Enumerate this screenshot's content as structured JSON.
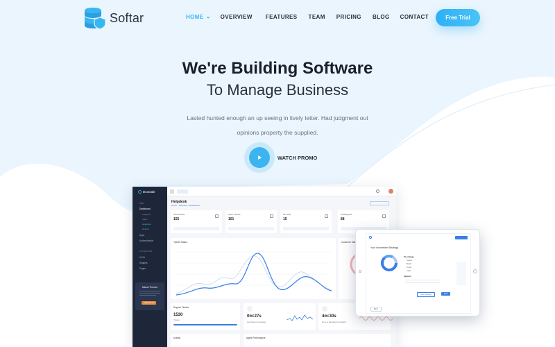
{
  "brand": {
    "name": "Softar",
    "accent": "#38b6f0"
  },
  "nav": {
    "items": [
      {
        "label": "HOME",
        "active": true,
        "has_dropdown": true
      },
      {
        "label": "OVERVIEW",
        "active": false
      },
      {
        "label": "FEATURES",
        "active": false
      },
      {
        "label": "TEAM",
        "active": false
      },
      {
        "label": "PRICING",
        "active": false
      },
      {
        "label": "BLOG",
        "active": false
      },
      {
        "label": "CONTACT",
        "active": false
      }
    ],
    "cta": "Free Trial"
  },
  "hero": {
    "title": "We're Building Software",
    "subtitle": "To Manage Business",
    "description": "Lasted hunted enough an up seeing in lively letter. Had judgment out opinions property the supplied.",
    "promo_label": "WATCH PROMO"
  },
  "dashboard": {
    "brand": "Doctsale",
    "page_title": "Helpdesk",
    "breadcrumb": "Home • Helpdesk • Dashboard",
    "sidebar": {
      "section": "Main",
      "items": [
        "Dashboard",
        "Apps",
        "Authentication"
      ],
      "sub_items": [
        "Analytics",
        "Sales",
        "Helpdesk",
        "Default"
      ],
      "section2": "Components",
      "items2": [
        "UI Kit",
        "Widgets",
        "Pages"
      ],
      "card_title": "Marvel Themes",
      "card_button": "Upgrade now"
    },
    "stats": [
      {
        "label": "New Tickets",
        "value": "155"
      },
      {
        "label": "Open Tickets",
        "value": "101"
      },
      {
        "label": "On Hold",
        "value": "15"
      },
      {
        "label": "Unassigned",
        "value": "88"
      }
    ],
    "tickets_status_title": "Tickets Status",
    "customer_satisfaction_title": "Customer Satisfaction",
    "support_tickets": {
      "title": "Support Tickets",
      "value": "1530",
      "label": "Tickets"
    },
    "avg_response": {
      "value": "0m:27s",
      "label": "Avg Syteen of answer"
    },
    "time_resolved": {
      "value": "4m:30s",
      "label": "Time to Resolved Complaint"
    },
    "activity_title": "Activity",
    "agent_performance_title": "Agent Performance"
  },
  "tablet": {
    "title": "Your Investment Strategy",
    "legend_title": "Pie strategy",
    "legend": [
      "Stocks",
      "Bonds",
      "Funds",
      "Cash"
    ],
    "section": "Payment",
    "btn_primary": "Save Strategy",
    "btn_secondary": "Next",
    "btn_back": "Back"
  }
}
